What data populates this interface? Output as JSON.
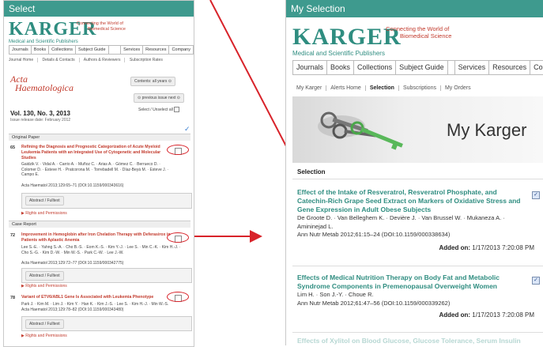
{
  "left_panel": {
    "title": "Select",
    "logo": "KARGER",
    "logo_sub": "Medical and Scientific Publishers",
    "tagline_1": "Connecting the World of",
    "tagline_2": "Biomedical Science",
    "nav": [
      "Journals",
      "Books",
      "Collections",
      "Subject Guide",
      "Services",
      "Resources",
      "Company"
    ],
    "subnav": [
      "Journal Home",
      "Details & Contacts",
      "Authors & Reviewers",
      "Subscription Rates"
    ],
    "journal_line1": "Acta",
    "journal_line2": "Haematologica",
    "contents_button": "Contents: all years",
    "prev_next": "previous issue next",
    "select_all": "Select / Unselect all",
    "volume": "Vol. 130, No. 3, 2013",
    "release_date": "Issue release date: February 2012",
    "sections": [
      {
        "label": "Original Paper",
        "articles": [
          {
            "num": "65",
            "title": "Refining the Diagnosis and Prognostic Categorization of Acute Myeloid Leukemia Patients with an Integrated Use of Cytogenetic and Molecular Studies",
            "authors": "Gaidzik V. · Vidal A. · Carrio A. · Muñoz C. · Arias A. · Gómez C. · Berrueco D. · Colomer D. · Esteve H. · Pratcorona M. · Torrebadell M. · Díaz-Beyá M. · Esteve J. · Campo E.",
            "citation": "Acta Haematol 2013;129:65–71 (DOI:10.1159/000343616)",
            "abstract_button": "Abstract / Fulltext",
            "rights": "Rights and Permissions"
          }
        ]
      },
      {
        "label": "Case Report",
        "articles": [
          {
            "num": "72",
            "title": "Improvement in Hemoglobin after Iron Chelation Therapy with Deferasirox in Patients with Aplastic Anemia",
            "authors": "Lee S.-E. · Yahng S.-A. · Cho B.-S. · Eom K.-S. · Kim Y.-J. · Lee S. · Min C.-K. · Kim H.-J. · Cho S.-G. · Kim D.-W. · Min W.-S. · Park C.-W. · Lee J.-W.",
            "citation": "Acta Haematol 2013;129:72–77 (DOI:10.1159/000342775)",
            "abstract_button": "Abstract / Fulltext",
            "rights": "Rights and Permissions"
          },
          {
            "num": "78",
            "title": "Variant of ETV6/ABL1 Gene Is Associated with Leukemia Phenotype",
            "authors": "Park J. · Kim M. · Lim J. · Kim Y. · Han K. · Kim J.-S. · Lee S. · Kim H.-J. · Min W.-S.",
            "citation": "Acta Haematol 2013;129:78–82 (DOI:10.1159/000343480)",
            "abstract_button": "Abstract / Fulltext",
            "rights": "Rights and Permissions"
          }
        ]
      }
    ]
  },
  "right_panel": {
    "title": "My Selection",
    "logo": "KARGER",
    "logo_sub": "Medical and Scientific Publishers",
    "tagline_1": "Connecting the World of",
    "tagline_2": "Biomedical Science",
    "nav": [
      "Journals",
      "Books",
      "Collections",
      "Subject Guide",
      "Services",
      "Resources",
      "Company"
    ],
    "subnav": [
      "My Karger",
      "Alerts Home",
      "Selection",
      "Subscriptions",
      "My Orders"
    ],
    "banner_text": "My Karger",
    "selection_heading": "Selection",
    "items": [
      {
        "title": "Effect of the Intake of Resveratrol, Resveratrol Phosphate, and Catechin-Rich Grape Seed Extract on Markers of Oxidative Stress and Gene Expression in Adult Obese Subjects",
        "authors": "De Groote D. · Van Belleghem K. · Devière J. · Van Brussel W. · Mukaneza A. · Amininejad L.",
        "citation": "Ann Nutr Metab 2012;61:15–24 (DOI:10.1159/000338634)",
        "added_label": "Added on:",
        "added_value": "1/17/2013 7:20:08 PM"
      },
      {
        "title": "Effects of Medical Nutrition Therapy on Body Fat and Metabolic Syndrome Components in Premenopausal Overweight Women",
        "authors": "Lim H. · Son J.-Y. · Choue R.",
        "citation": "Ann Nutr Metab 2012;61:47–56 (DOI:10.1159/000339262)",
        "added_label": "Added on:",
        "added_value": "1/17/2013 7:20:08 PM"
      }
    ],
    "faded_title": "Effects of Xylitol on Blood Glucose, Glucose Tolerance, Serum Insulin"
  },
  "colors": {
    "header_teal": "#3e9a8e",
    "link_teal": "#2f8d80",
    "article_red": "#c23a2c",
    "annotation_red": "#d8232a"
  }
}
